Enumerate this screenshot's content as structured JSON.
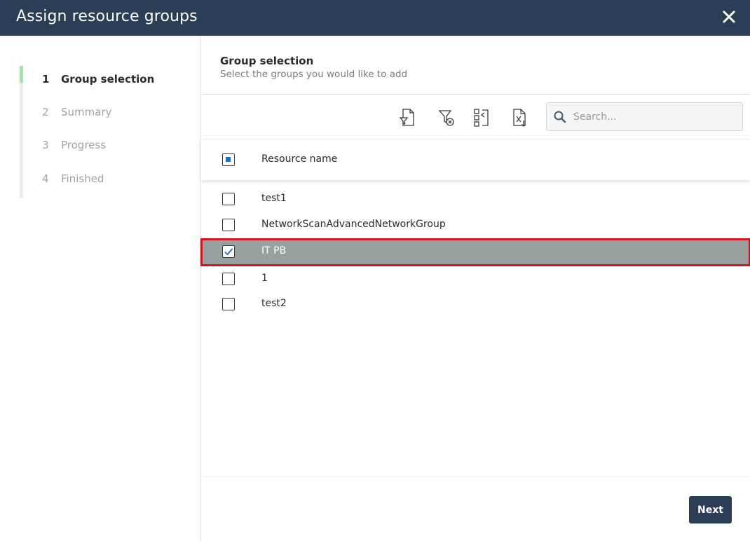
{
  "dialog": {
    "title": "Assign resource groups",
    "close_icon": "close-icon"
  },
  "wizard": {
    "steps": [
      {
        "number": "1",
        "label": "Group selection",
        "state": "active"
      },
      {
        "number": "2",
        "label": "Summary",
        "state": "pending"
      },
      {
        "number": "3",
        "label": "Progress",
        "state": "pending"
      },
      {
        "number": "4",
        "label": "Finished",
        "state": "pending"
      }
    ],
    "active_color": "#a6e0b0"
  },
  "main": {
    "title": "Group selection",
    "subtitle": "Select the groups you would like to add",
    "toolbar": {
      "icons": [
        "filter-document-icon",
        "clear-filter-icon",
        "column-settings-icon",
        "export-excel-icon"
      ],
      "search_placeholder": "Search...",
      "search_value": ""
    },
    "table": {
      "header_checkbox_state": "partial",
      "column_header": "Resource name",
      "rows": [
        {
          "name": "test1",
          "checked": false
        },
        {
          "name": "NetworkScanAdvancedNetworkGroup",
          "checked": false
        },
        {
          "name": "IT PB",
          "checked": true
        },
        {
          "name": "1",
          "checked": false
        },
        {
          "name": "test2",
          "checked": false
        }
      ]
    },
    "next_label": "Next"
  },
  "colors": {
    "header_bg": "#2c3e55",
    "selected_row_bg": "#97a1a0",
    "highlight_border": "#d0161b",
    "checkbox_accent": "#1f6fc4"
  }
}
